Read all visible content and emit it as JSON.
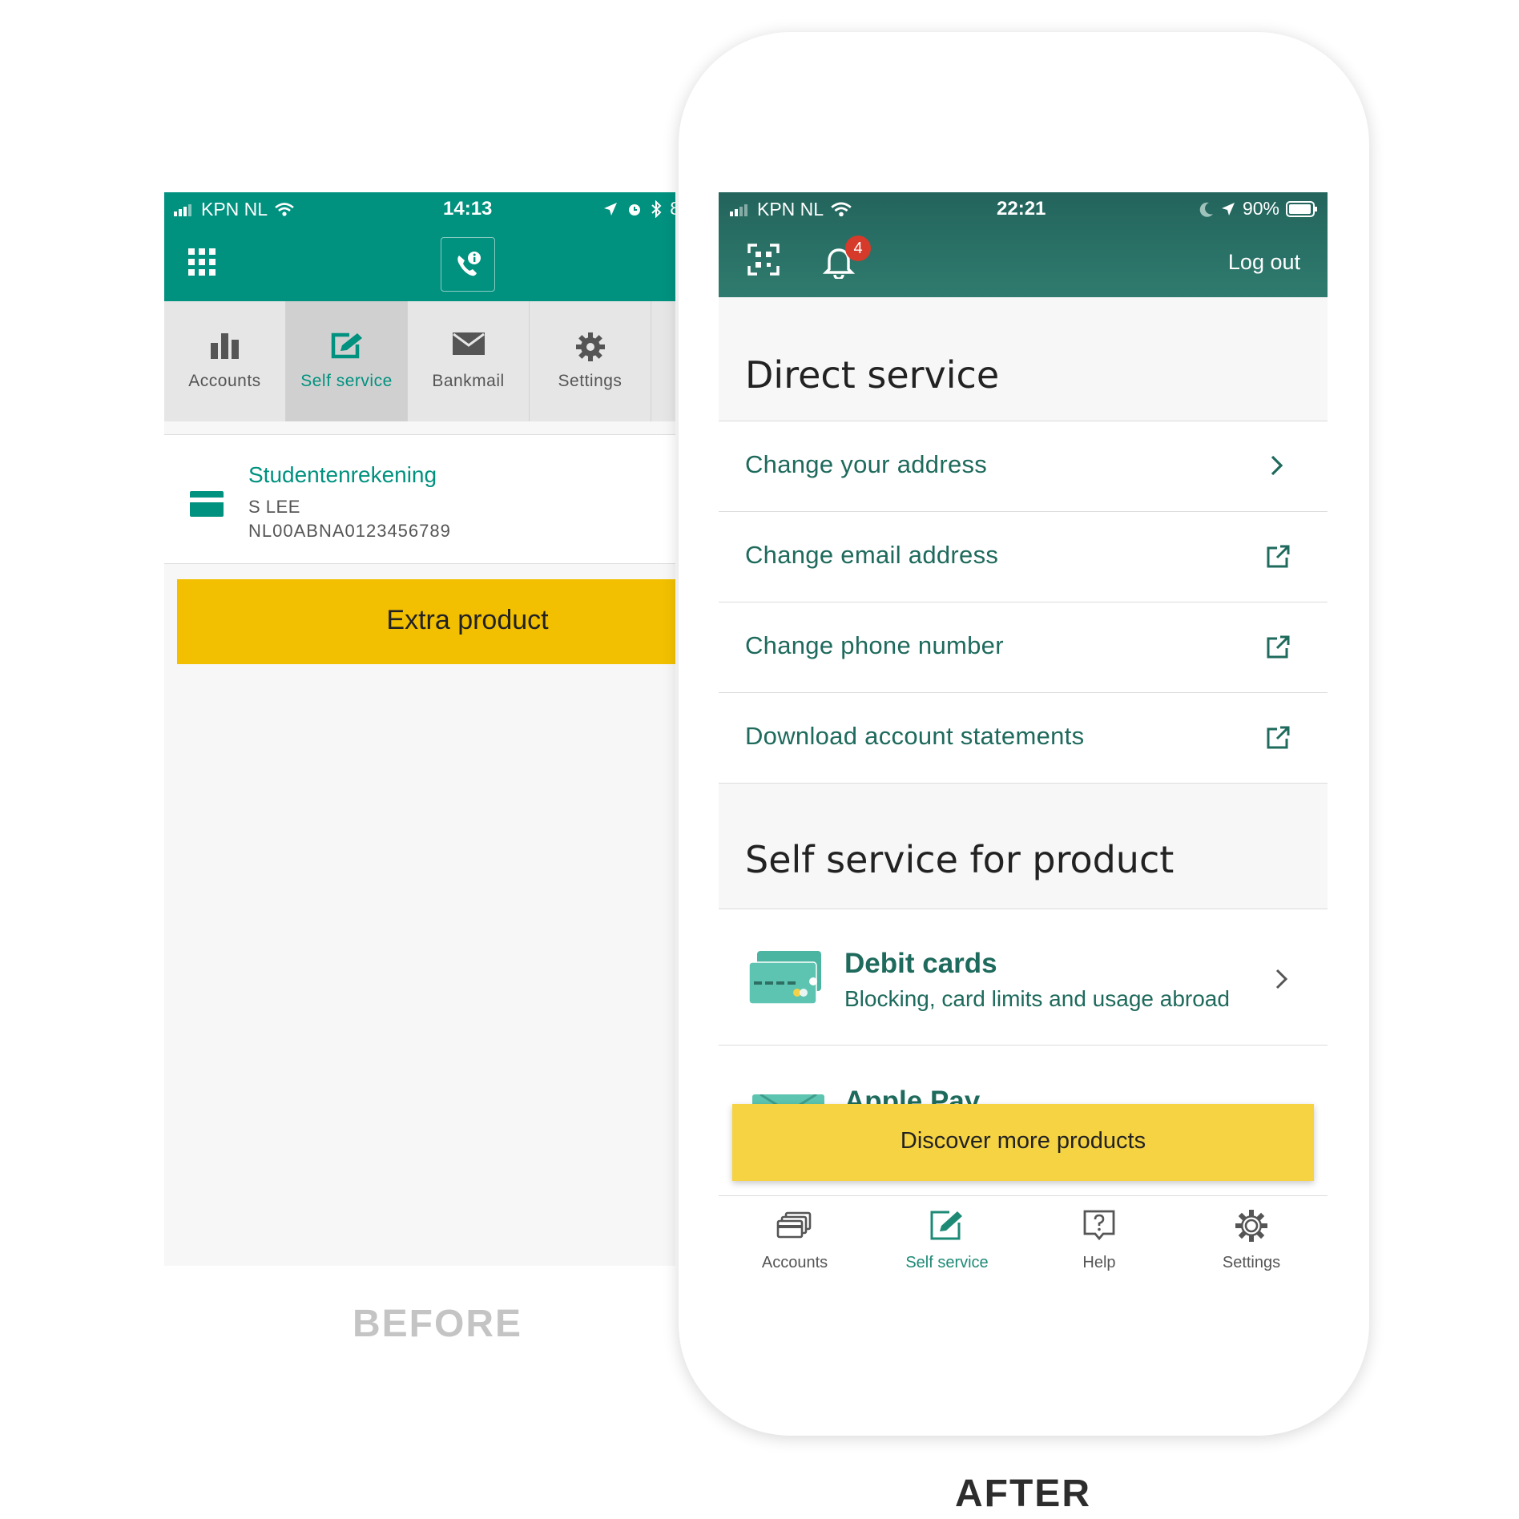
{
  "before": {
    "status": {
      "carrier": "KPN NL",
      "time": "14:13",
      "battery_fragment": "8"
    },
    "tabs": [
      {
        "label": "Accounts",
        "icon": "bar-chart-icon",
        "active": false
      },
      {
        "label": "Self service",
        "icon": "edit-icon",
        "active": true
      },
      {
        "label": "Bankmail",
        "icon": "mail-icon",
        "active": false
      },
      {
        "label": "Settings",
        "icon": "gear-icon",
        "active": false
      }
    ],
    "account": {
      "name": "Studentenrekening",
      "owner": "S LEE",
      "iban": "NL00ABNA0123456789"
    },
    "extra_button": "Extra product",
    "caption": "BEFORE"
  },
  "after": {
    "status": {
      "carrier": "KPN NL",
      "time": "22:21",
      "battery": "90%"
    },
    "notification_count": "4",
    "logout": "Log out",
    "direct_title": "Direct service",
    "direct_items": [
      {
        "label": "Change your address",
        "icon": "chevron-right-icon"
      },
      {
        "label": "Change email address",
        "icon": "external-link-icon"
      },
      {
        "label": "Change phone number",
        "icon": "external-link-icon"
      },
      {
        "label": "Download account statements",
        "icon": "external-link-icon"
      }
    ],
    "product_title": "Self service for product",
    "products": [
      {
        "title": "Debit cards",
        "subtitle": "Blocking, card limits and usage abroad"
      },
      {
        "title": "Apple Pay"
      }
    ],
    "discover_button": "Discover more products",
    "tabs": [
      {
        "label": "Accounts",
        "icon": "cards-icon",
        "active": false
      },
      {
        "label": "Self service",
        "icon": "edit-icon",
        "active": true
      },
      {
        "label": "Help",
        "icon": "help-icon",
        "active": false
      },
      {
        "label": "Settings",
        "icon": "gear-icon",
        "active": false
      }
    ],
    "caption": "AFTER"
  },
  "colors": {
    "teal": "#00917f",
    "dark_teal": "#23645c",
    "yellow_before": "#f2c000",
    "yellow_after": "#f6d343",
    "text_teal": "#1e6a5c",
    "badge": "#d63a2a"
  }
}
